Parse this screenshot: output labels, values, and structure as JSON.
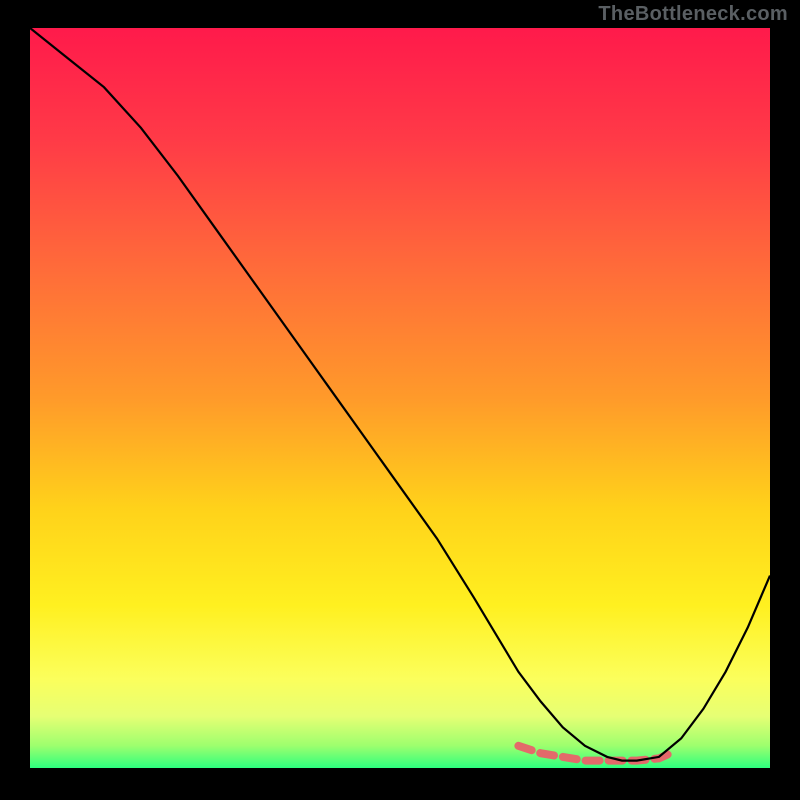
{
  "watermark": "TheBottleneck.com",
  "chart_data": {
    "type": "line",
    "title": "",
    "xlabel": "",
    "ylabel": "",
    "xlim": [
      0,
      100
    ],
    "ylim": [
      0,
      100
    ],
    "background_gradient": {
      "stops": [
        {
          "offset": 0.0,
          "color": "#ff1a4b"
        },
        {
          "offset": 0.15,
          "color": "#ff3a47"
        },
        {
          "offset": 0.32,
          "color": "#ff6a3a"
        },
        {
          "offset": 0.5,
          "color": "#ff9a2a"
        },
        {
          "offset": 0.65,
          "color": "#ffd21a"
        },
        {
          "offset": 0.78,
          "color": "#fff020"
        },
        {
          "offset": 0.88,
          "color": "#fbff5c"
        },
        {
          "offset": 0.93,
          "color": "#e6ff74"
        },
        {
          "offset": 0.97,
          "color": "#9dff6e"
        },
        {
          "offset": 1.0,
          "color": "#2dff7e"
        }
      ]
    },
    "series": [
      {
        "name": "bottleneck-curve",
        "x": [
          0,
          5,
          10,
          15,
          20,
          25,
          30,
          35,
          40,
          45,
          50,
          55,
          60,
          63,
          66,
          69,
          72,
          75,
          78,
          80,
          82,
          85,
          88,
          91,
          94,
          97,
          100
        ],
        "y": [
          100,
          96,
          92,
          86.5,
          80,
          73,
          66,
          59,
          52,
          45,
          38,
          31,
          23,
          18,
          13,
          9,
          5.5,
          3,
          1.5,
          1,
          1,
          1.5,
          4,
          8,
          13,
          19,
          26
        ],
        "color": "#000000",
        "width": 2.2
      }
    ],
    "highlight": {
      "name": "optimal-band",
      "x": [
        66,
        69,
        72,
        75,
        78,
        80,
        82,
        85,
        87.2
      ],
      "y": [
        3,
        2,
        1.5,
        1,
        1,
        1,
        1,
        1.3,
        2.3
      ],
      "color": "#e36a6a",
      "width": 8,
      "dasharray": "14 9"
    }
  }
}
